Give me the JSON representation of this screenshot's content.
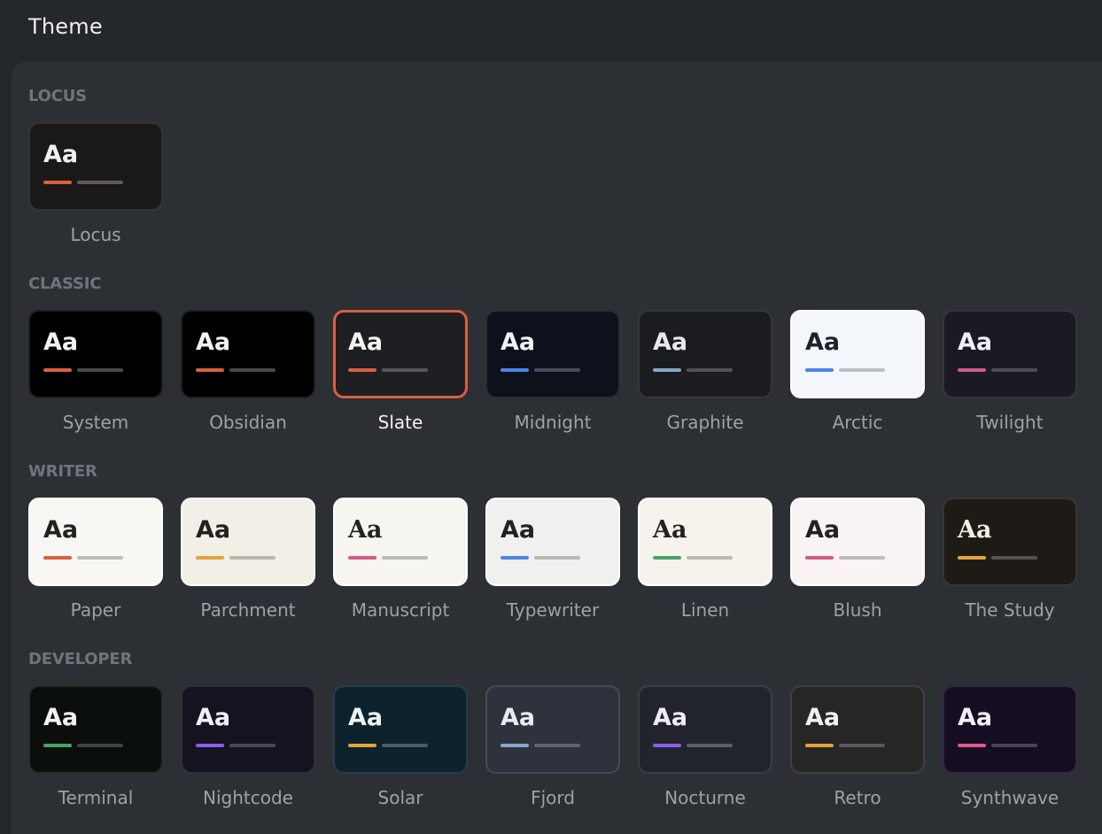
{
  "page": {
    "title": "Theme"
  },
  "sections": [
    {
      "heading": "LOCUS",
      "themes": [
        {
          "name": "Locus",
          "preview": "Aa",
          "bg": "#1a1917",
          "text": "#f2f0ec",
          "accent": "#d9603f",
          "line": "#5e5b57",
          "serif": false,
          "light": false,
          "selected": false
        }
      ]
    },
    {
      "heading": "CLASSIC",
      "themes": [
        {
          "name": "System",
          "preview": "Aa",
          "bg": "#000000",
          "text": "#f2f2f2",
          "accent": "#d9603f",
          "line": "#4a4a4a",
          "serif": false,
          "light": false,
          "selected": false
        },
        {
          "name": "Obsidian",
          "preview": "Aa",
          "bg": "#000000",
          "text": "#f2f2f2",
          "accent": "#d9603f",
          "line": "#4a4a4a",
          "serif": false,
          "light": false,
          "selected": false
        },
        {
          "name": "Slate",
          "preview": "Aa",
          "bg": "#1e1f22",
          "text": "#f2f2f2",
          "accent": "#d9603f",
          "line": "#55575b",
          "serif": false,
          "light": false,
          "selected": true
        },
        {
          "name": "Midnight",
          "preview": "Aa",
          "bg": "#0c111b",
          "text": "#eef1f6",
          "accent": "#4a86e8",
          "line": "#474c56",
          "serif": false,
          "light": false,
          "selected": false
        },
        {
          "name": "Graphite",
          "preview": "Aa",
          "bg": "#1b1c1f",
          "text": "#e8e9eb",
          "accent": "#8aa6c8",
          "line": "#505257",
          "serif": false,
          "light": false,
          "selected": false
        },
        {
          "name": "Arctic",
          "preview": "Aa",
          "bg": "#f3f7fb",
          "text": "#1d232b",
          "accent": "#4a86e8",
          "line": "#bcc0c4",
          "serif": false,
          "light": true,
          "selected": false
        },
        {
          "name": "Twilight",
          "preview": "Aa",
          "bg": "#1b1a22",
          "text": "#f0eef4",
          "accent": "#d35a86",
          "line": "#4e4c55",
          "serif": false,
          "light": false,
          "selected": false
        }
      ]
    },
    {
      "heading": "WRITER",
      "themes": [
        {
          "name": "Paper",
          "preview": "Aa",
          "bg": "#f8f7f3",
          "text": "#222222",
          "accent": "#d9603f",
          "line": "#bdbcb8",
          "serif": false,
          "light": true,
          "selected": false
        },
        {
          "name": "Parchment",
          "preview": "Aa",
          "bg": "#f2efe6",
          "text": "#222222",
          "accent": "#e6a23c",
          "line": "#bab7ae",
          "serif": false,
          "light": true,
          "selected": false
        },
        {
          "name": "Manuscript",
          "preview": "Aa",
          "bg": "#f6f5f0",
          "text": "#222222",
          "accent": "#d35a86",
          "line": "#bdbcb7",
          "serif": true,
          "light": true,
          "selected": false
        },
        {
          "name": "Typewriter",
          "preview": "Aa",
          "bg": "#f0f0ee",
          "text": "#222222",
          "accent": "#4a86e8",
          "line": "#b9b9b7",
          "serif": false,
          "light": true,
          "selected": false
        },
        {
          "name": "Linen",
          "preview": "Aa",
          "bg": "#f6f3ec",
          "text": "#222222",
          "accent": "#4aa36a",
          "line": "#bebbb4",
          "serif": true,
          "light": true,
          "selected": false
        },
        {
          "name": "Blush",
          "preview": "Aa",
          "bg": "#f9f4f3",
          "text": "#222222",
          "accent": "#d35a86",
          "line": "#c1bcbb",
          "serif": false,
          "light": true,
          "selected": false
        },
        {
          "name": "The Study",
          "preview": "Aa",
          "bg": "#1e1b16",
          "text": "#f2ede2",
          "accent": "#e6a23c",
          "line": "#57534c",
          "serif": true,
          "light": false,
          "selected": false
        }
      ]
    },
    {
      "heading": "DEVELOPER",
      "themes": [
        {
          "name": "Terminal",
          "preview": "Aa",
          "bg": "#0b0f0c",
          "text": "#f0f2f0",
          "accent": "#4aa36a",
          "line": "#40443f",
          "serif": false,
          "light": false,
          "selected": false
        },
        {
          "name": "Nightcode",
          "preview": "Aa",
          "bg": "#15131f",
          "text": "#f0eef6",
          "accent": "#8a5cf0",
          "line": "#4b4856",
          "serif": false,
          "light": false,
          "selected": false
        },
        {
          "name": "Solar",
          "preview": "Aa",
          "bg": "#0c232d",
          "text": "#eef3f5",
          "accent": "#e6a23c",
          "line": "#485e66",
          "serif": false,
          "light": false,
          "selected": false
        },
        {
          "name": "Fjord",
          "preview": "Aa",
          "bg": "#2d323d",
          "text": "#e8ebef",
          "accent": "#8aa6c8",
          "line": "#5e6470",
          "serif": false,
          "light": false,
          "selected": false
        },
        {
          "name": "Nocturne",
          "preview": "Aa",
          "bg": "#22242d",
          "text": "#eceef3",
          "accent": "#8a5cf0",
          "line": "#5a5d67",
          "serif": false,
          "light": false,
          "selected": false
        },
        {
          "name": "Retro",
          "preview": "Aa",
          "bg": "#262626",
          "text": "#f0f0f0",
          "accent": "#e6a23c",
          "line": "#5a5a5a",
          "serif": false,
          "light": false,
          "selected": false
        },
        {
          "name": "Synthwave",
          "preview": "Aa",
          "bg": "#150d22",
          "text": "#f3eef8",
          "accent": "#e0578c",
          "line": "#4b4257",
          "serif": false,
          "light": false,
          "selected": false
        }
      ]
    }
  ]
}
